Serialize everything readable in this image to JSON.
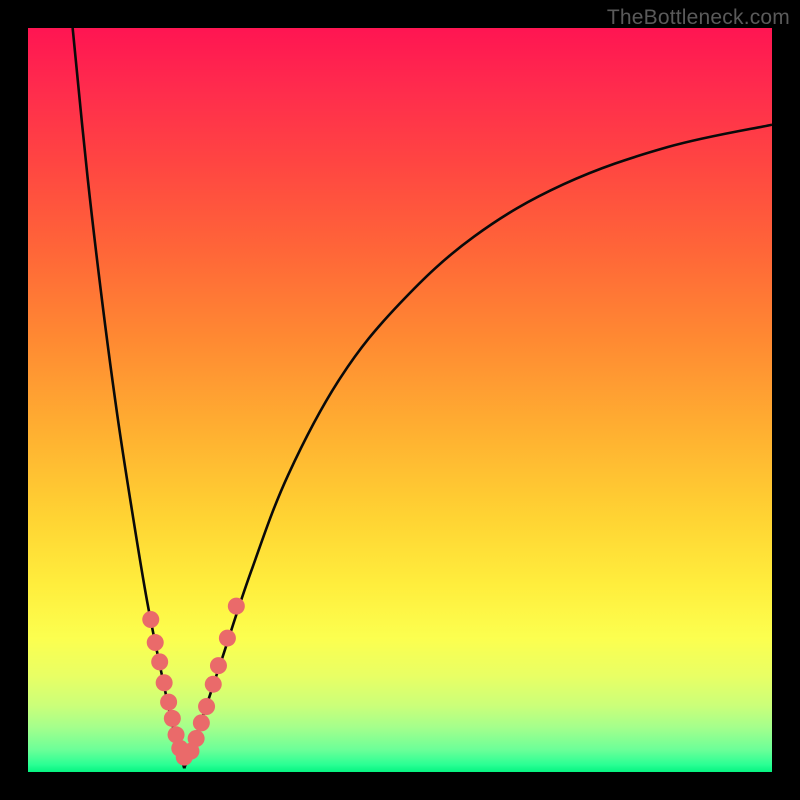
{
  "watermark": "TheBottleneck.com",
  "colors": {
    "background": "#000000",
    "curve": "#0a0a0a",
    "points": "#ea6a6a",
    "points_stroke": "#d45858"
  },
  "chart_data": {
    "type": "line",
    "title": "",
    "xlabel": "",
    "ylabel": "",
    "xlim": [
      0,
      100
    ],
    "ylim": [
      0,
      100
    ],
    "grid": false,
    "axes_hidden": true,
    "notch_x": 21,
    "description": "Two monotone curves descending to a shared minimum near x≈21, forming a V against a vertical red→green gradient. Scattered salmon points sit on the lower portion of both arms of the V.",
    "series": [
      {
        "name": "left-branch",
        "x": [
          6,
          8,
          10,
          12,
          14,
          16,
          18,
          19.5,
          21
        ],
        "y": [
          100,
          80,
          63,
          48,
          35,
          23,
          13,
          6,
          0.5
        ]
      },
      {
        "name": "right-branch",
        "x": [
          21,
          23,
          26,
          30,
          35,
          42,
          50,
          60,
          72,
          86,
          100
        ],
        "y": [
          0.5,
          6,
          15,
          27,
          40,
          53,
          63,
          72,
          79,
          84,
          87
        ]
      }
    ],
    "points": [
      {
        "x": 16.5,
        "y": 20.5
      },
      {
        "x": 17.1,
        "y": 17.4
      },
      {
        "x": 17.7,
        "y": 14.8
      },
      {
        "x": 18.3,
        "y": 12.0
      },
      {
        "x": 18.9,
        "y": 9.4
      },
      {
        "x": 19.4,
        "y": 7.2
      },
      {
        "x": 19.9,
        "y": 5.0
      },
      {
        "x": 20.4,
        "y": 3.2
      },
      {
        "x": 21.0,
        "y": 2.0
      },
      {
        "x": 21.9,
        "y": 2.8
      },
      {
        "x": 22.6,
        "y": 4.5
      },
      {
        "x": 23.3,
        "y": 6.6
      },
      {
        "x": 24.0,
        "y": 8.8
      },
      {
        "x": 24.9,
        "y": 11.8
      },
      {
        "x": 25.6,
        "y": 14.3
      },
      {
        "x": 26.8,
        "y": 18.0
      },
      {
        "x": 28.0,
        "y": 22.3
      }
    ]
  }
}
